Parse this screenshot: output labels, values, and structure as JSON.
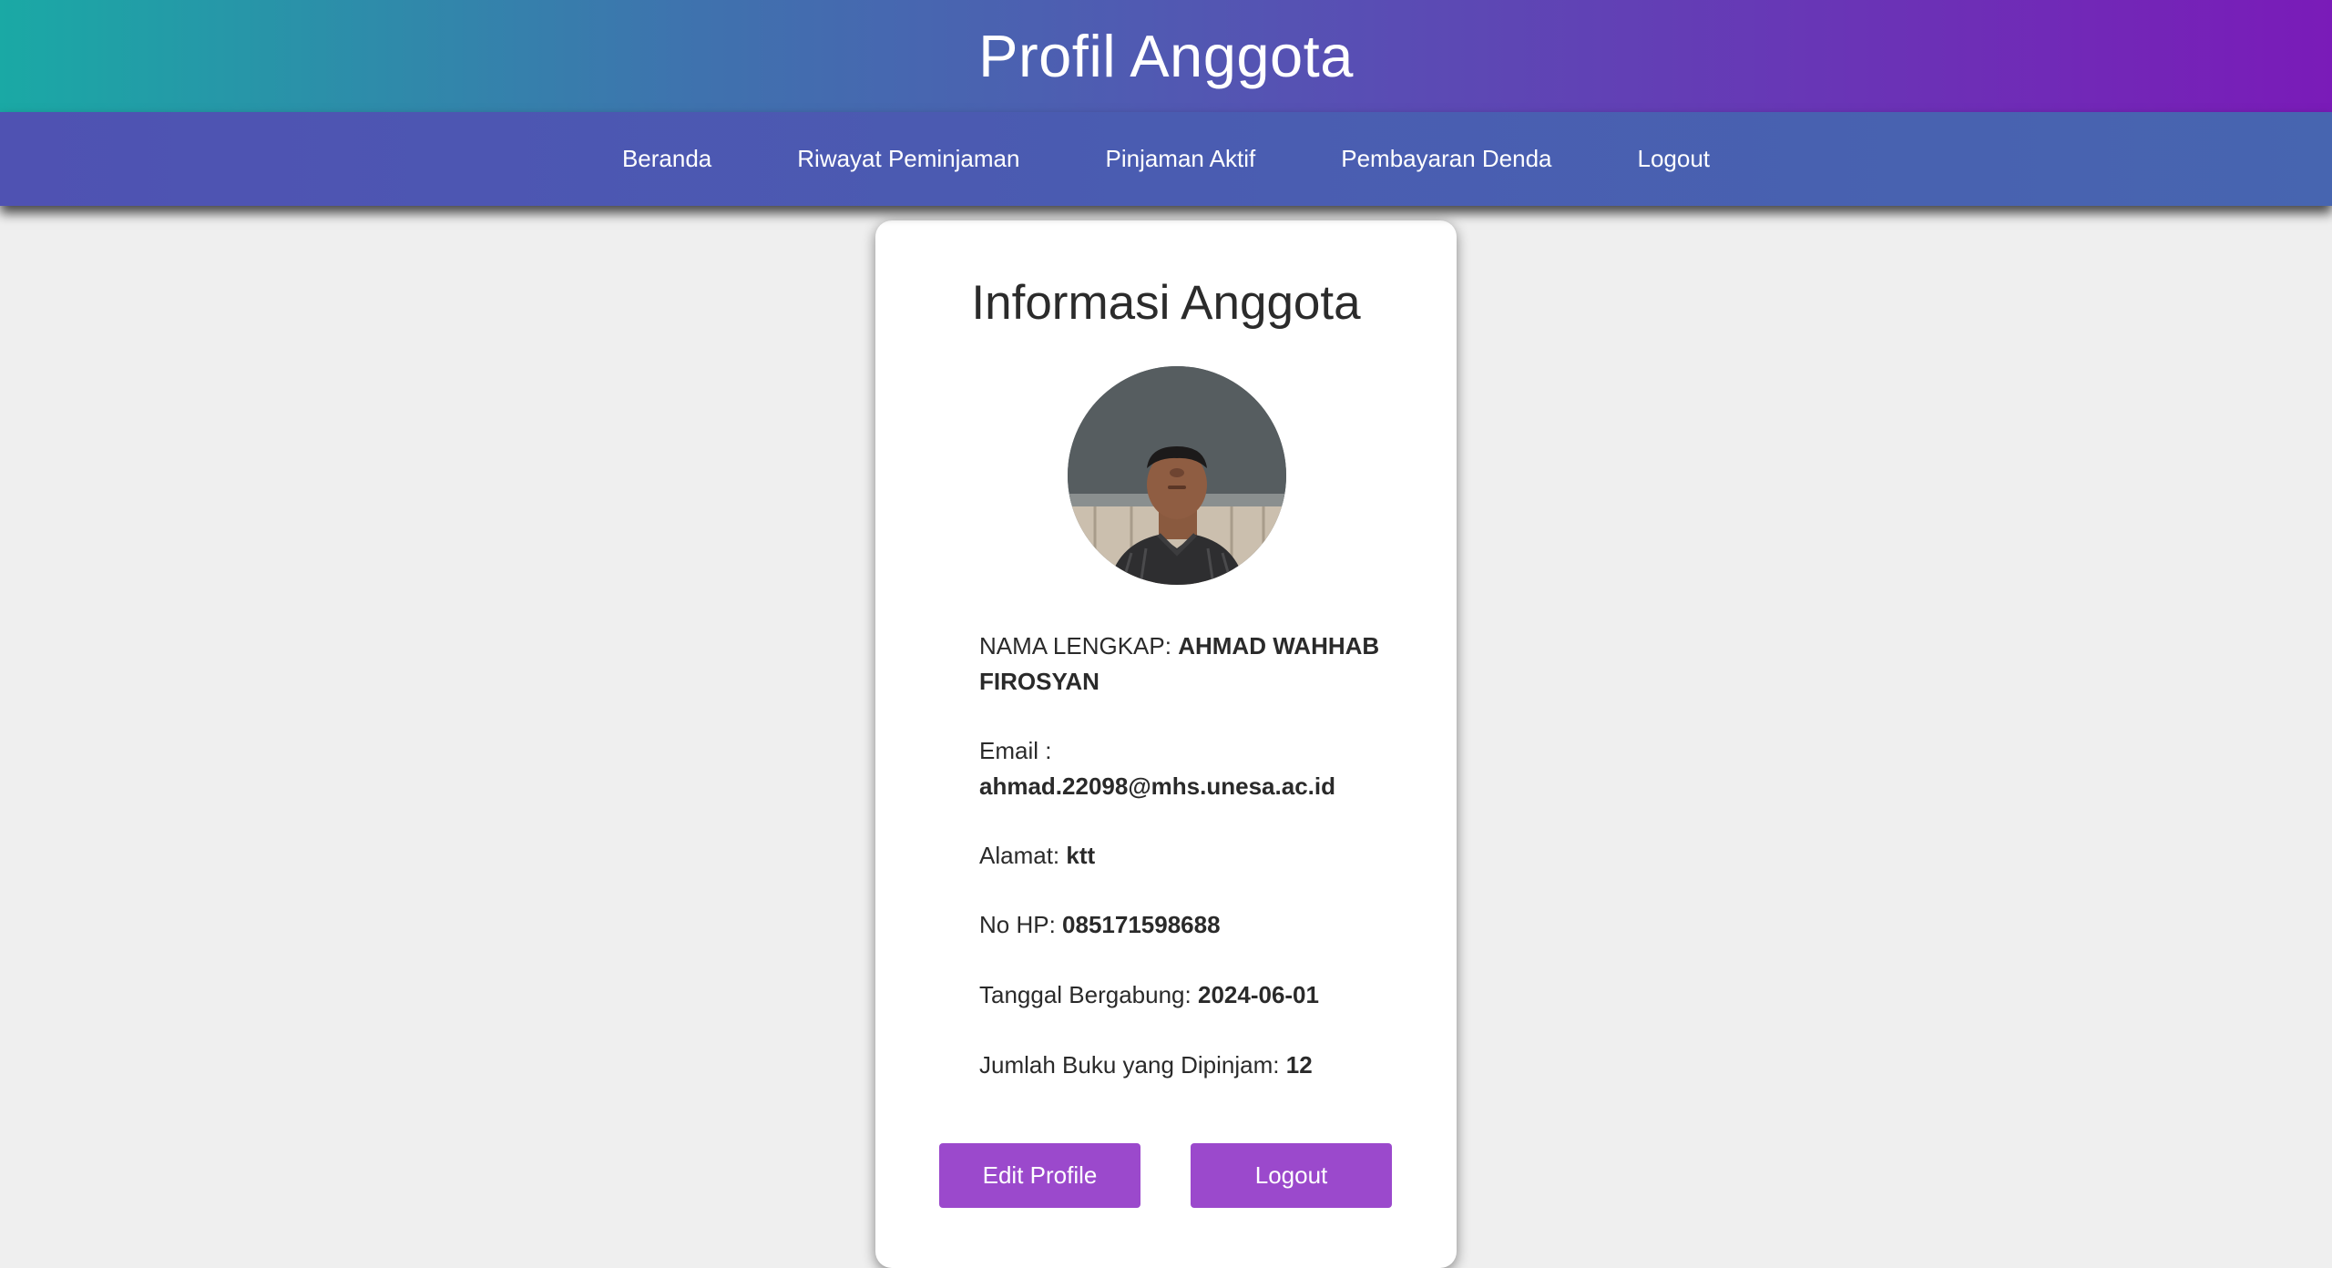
{
  "header": {
    "title": "Profil Anggota"
  },
  "nav": {
    "items": [
      {
        "label": "Beranda"
      },
      {
        "label": "Riwayat Peminjaman"
      },
      {
        "label": "Pinjaman Aktif"
      },
      {
        "label": "Pembayaran Denda"
      },
      {
        "label": "Logout"
      }
    ]
  },
  "card": {
    "title": "Informasi Anggota",
    "fields": {
      "nama": {
        "label": "NAMA LENGKAP:",
        "value": "AHMAD WAHHAB FIROSYAN"
      },
      "email": {
        "label": "Email :",
        "value": "ahmad.22098@mhs.unesa.ac.id"
      },
      "alamat": {
        "label": "Alamat:",
        "value": "ktt"
      },
      "nohp": {
        "label": "No HP:",
        "value": "085171598688"
      },
      "tanggal": {
        "label": "Tanggal Bergabung:",
        "value": "2024-06-01"
      },
      "jumlah": {
        "label": "Jumlah Buku yang Dipinjam:",
        "value": "12"
      }
    },
    "buttons": {
      "edit": "Edit Profile",
      "logout": "Logout"
    }
  },
  "colors": {
    "header_gradient": [
      "#1aa9a5",
      "#3f72ae",
      "#5a4cb4",
      "#7a1bb8"
    ],
    "nav_bg": "#4f52b2",
    "button_bg": "#9b49cc",
    "page_bg": "#efefef"
  }
}
